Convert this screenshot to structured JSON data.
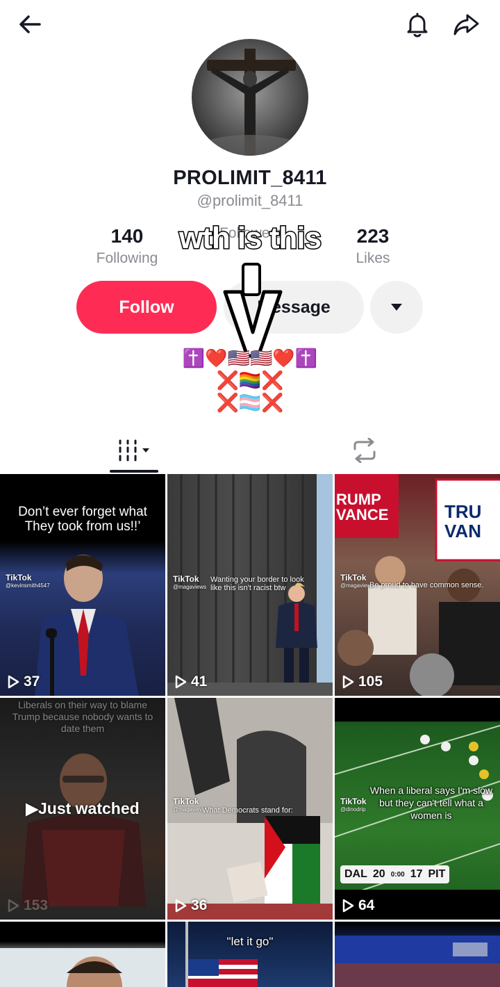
{
  "header": {
    "back_icon": "back-arrow-icon",
    "bell_icon": "bell-icon",
    "share_icon": "share-icon"
  },
  "profile": {
    "username": "PROLIMIT_8411",
    "handle": "@prolimit_8411",
    "stats": {
      "following": {
        "value": "140",
        "label": "Following"
      },
      "followers": {
        "value": "",
        "label": "Followers"
      },
      "likes": {
        "value": "223",
        "label": "Likes"
      }
    },
    "overlay_text": "wth is this",
    "buttons": {
      "follow": "Follow",
      "message": "Message"
    },
    "bio": [
      "✝️❤️🇺🇸🇺🇸❤️✝️",
      "❌🏳️‍🌈❌",
      "❌🏳️‍⚧️❌"
    ]
  },
  "tabs": {
    "videos_icon": "grid-videos-icon",
    "reposts_icon": "repost-icon"
  },
  "videos": [
    {
      "caption": "Don’t ever forget what They took from us!!’",
      "watermark": "TikTok",
      "watermark_user": "@kevinsmith4547",
      "views": "37"
    },
    {
      "caption": "Wanting your border to look like this isn't racist btw",
      "watermark": "TikTok",
      "watermark_user": "@magaviews",
      "views": "41"
    },
    {
      "caption": "Be proud to have common sense.",
      "watermark": "TikTok",
      "watermark_user": "@magaviews",
      "sign_a": "RUMP VANCE",
      "sign_b": "TRU VAN",
      "views": "105"
    },
    {
      "caption": "Liberals on their way to blame Trump because nobody wants to date them",
      "overlay": "Just watched",
      "views": "153"
    },
    {
      "caption": "What Democrats stand for:",
      "watermark": "TikTok",
      "watermark_user": "@magaviews",
      "views": "36"
    },
    {
      "caption": "When a liberal says I'm slow but they can't tell what a women is",
      "watermark": "TikTok",
      "watermark_user": "@dinodrip",
      "score": {
        "away": "DAL",
        "away_score": "20",
        "clock": "0:00",
        "home_score": "17",
        "home": "PIT"
      },
      "views": "64"
    },
    {
      "caption": "",
      "views": ""
    },
    {
      "caption": "\"let it go\"",
      "views": ""
    },
    {
      "caption": "",
      "views": ""
    }
  ]
}
